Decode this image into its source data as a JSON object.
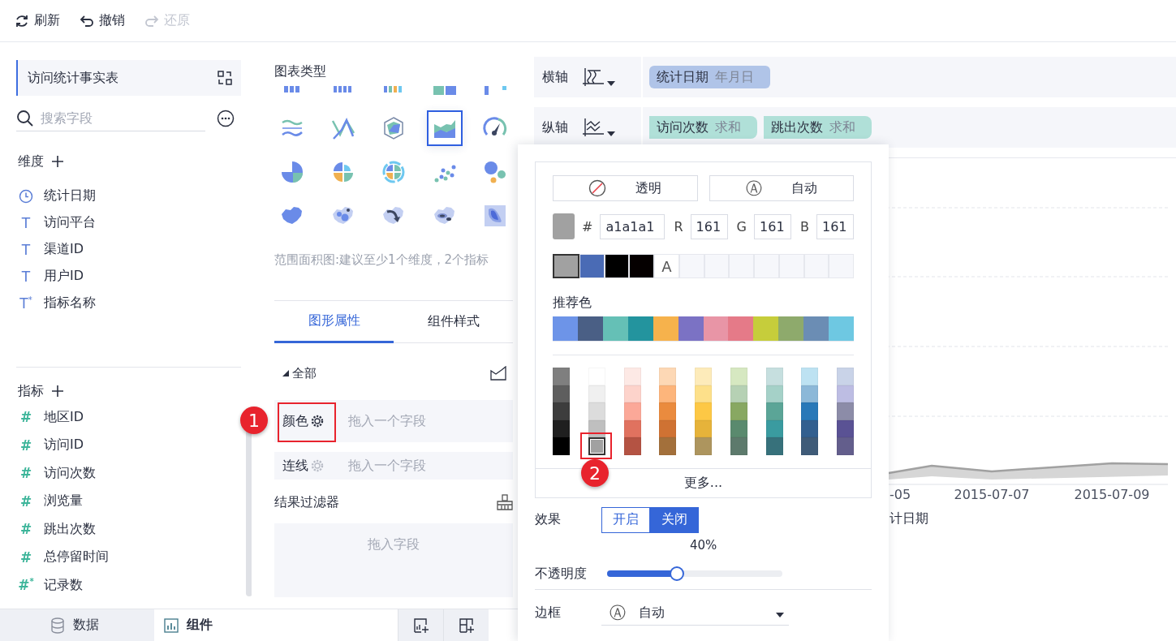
{
  "toolbar": [
    {
      "kind": "refresh",
      "label": "刷新",
      "disabled": false
    },
    {
      "kind": "undo",
      "label": "撤销",
      "disabled": false
    },
    {
      "kind": "redo",
      "label": "还原",
      "disabled": true
    }
  ],
  "data_panel": {
    "table": "访问统计事实表",
    "search": {
      "placeholder": "搜索字段"
    },
    "dimensions": {
      "title": "维度",
      "items": [
        {
          "kind": "date",
          "label": "统计日期"
        },
        {
          "kind": "dimension",
          "icon": "T",
          "label": "访问平台"
        },
        {
          "kind": "dimension",
          "icon": "T",
          "label": "渠道ID"
        },
        {
          "kind": "dimension",
          "icon": "T",
          "label": "用户ID"
        },
        {
          "kind": "dimension",
          "icon": "T$^{*}$",
          "label": "指标名称"
        }
      ]
    },
    "measures": {
      "title": "指标",
      "items": [
        {
          "kind": "measure",
          "icon": "#",
          "label": "地区ID"
        },
        {
          "kind": "measure",
          "icon": "#",
          "label": "访问ID"
        },
        {
          "kind": "measure",
          "icon": "#",
          "label": "访问次数"
        },
        {
          "kind": "measure",
          "icon": "#",
          "label": "浏览量"
        },
        {
          "kind": "measure",
          "icon": "#",
          "label": "跳出次数"
        },
        {
          "kind": "measure",
          "icon": "#",
          "label": "总停留时间"
        },
        {
          "kind": "measure",
          "icon": "#$^{*}$",
          "label": "记录数"
        }
      ]
    }
  },
  "bottom_tabs": [
    {
      "kind": "data",
      "label": "数据",
      "selected": false
    },
    {
      "kind": "component",
      "label": "组件",
      "selected": true
    }
  ],
  "chart_panel": {
    "title": "图表类型",
    "chart_types": [
      {
        "kind": "column",
        "selected": false
      },
      {
        "kind": "column-stack",
        "selected": false
      },
      {
        "kind": "column-multi",
        "selected": false
      },
      {
        "kind": "bar-range",
        "selected": false
      },
      {
        "kind": "column-partial",
        "selected": false
      },
      {
        "kind": "stream",
        "selected": false
      },
      {
        "kind": "line",
        "selected": false
      },
      {
        "kind": "radar",
        "selected": false
      },
      {
        "kind": "area",
        "selected": true
      },
      {
        "kind": "gauge",
        "selected": false
      },
      {
        "kind": "pie",
        "selected": false
      },
      {
        "kind": "rose",
        "selected": false
      },
      {
        "kind": "ring",
        "selected": false
      },
      {
        "kind": "scatter",
        "selected": false
      },
      {
        "kind": "bubble",
        "selected": false
      },
      {
        "kind": "map",
        "selected": false
      },
      {
        "kind": "map-point",
        "selected": false
      },
      {
        "kind": "map-flow",
        "selected": false
      },
      {
        "kind": "map-heat",
        "selected": false
      },
      {
        "kind": "map-region",
        "selected": false
      }
    ],
    "hint": "范围面积图:建议至少1个维度，2个指标",
    "tabs": [
      {
        "label": "图形属性",
        "selected": true
      },
      {
        "label": "组件样式",
        "selected": false
      }
    ],
    "group": {
      "label": "全部",
      "expanded": true
    },
    "properties": [
      {
        "label": "颜色",
        "placeholder": "拖入一个字段"
      },
      {
        "label": "连线",
        "placeholder": "拖入一个字段"
      }
    ],
    "filter": {
      "title": "结果过滤器",
      "placeholder": "拖入字段"
    }
  },
  "axes": [
    {
      "label": "横轴",
      "kind": "x",
      "fields": [
        {
          "name": "统计日期",
          "aggregation": "年月日"
        }
      ]
    },
    {
      "label": "纵轴",
      "kind": "y",
      "fields": [
        {
          "name": "访问次数",
          "aggregation": "求和"
        },
        {
          "name": "跳出次数",
          "aggregation": "求和"
        }
      ]
    }
  ],
  "chart": {
    "x_labels": [
      "-05",
      "2015-07-07",
      "2015-07-09"
    ],
    "axis_title": "计日期"
  },
  "color_popup": {
    "transparent": "透明",
    "auto_icon": "Ⓐ",
    "auto": "自动",
    "hash": "#",
    "hex": "a1a1a1",
    "channels": [
      {
        "label": "R",
        "value": "161"
      },
      {
        "label": "G",
        "value": "161"
      },
      {
        "label": "B",
        "value": "161"
      }
    ],
    "recent": [
      {
        "kind": "color",
        "color": "#a1a1a1",
        "selected": true
      },
      {
        "kind": "color",
        "color": "#4a6bb5",
        "selected": false
      },
      {
        "kind": "color",
        "color": "#000000",
        "selected": false
      },
      {
        "kind": "color",
        "color": "#050000",
        "selected": false
      },
      {
        "kind": "auto",
        "label": "A",
        "selected": false
      },
      {
        "kind": "empty",
        "selected": false
      },
      {
        "kind": "empty",
        "selected": false
      },
      {
        "kind": "empty",
        "selected": false
      },
      {
        "kind": "empty",
        "selected": false
      },
      {
        "kind": "empty",
        "selected": false
      },
      {
        "kind": "empty",
        "selected": false
      },
      {
        "kind": "empty",
        "selected": false
      }
    ],
    "recommended_title": "推荐色",
    "recommended": [
      {
        "color": "#6d94e8",
        "selected": false
      },
      {
        "color": "#4a5f85",
        "selected": false
      },
      {
        "color": "#65c0b6",
        "selected": false
      },
      {
        "color": "#23949e",
        "selected": false
      },
      {
        "color": "#f6b24c",
        "selected": false
      },
      {
        "color": "#7b72c4",
        "selected": false
      },
      {
        "color": "#e895a6",
        "selected": false
      },
      {
        "color": "#e57a88",
        "selected": false
      },
      {
        "color": "#c6cd3b",
        "selected": false
      },
      {
        "color": "#8eaa6c",
        "selected": false
      },
      {
        "color": "#6b8db4",
        "selected": false
      },
      {
        "color": "#6ec8e2",
        "selected": false
      }
    ],
    "shades": [
      {
        "cells": [
          {
            "color": "#7f7f7f",
            "selected": false
          },
          {
            "color": "#5e5e5e",
            "selected": false
          },
          {
            "color": "#3d3d3d",
            "selected": false
          },
          {
            "color": "#1f1f1f",
            "selected": false
          },
          {
            "color": "#000000",
            "selected": false
          }
        ]
      },
      {
        "cells": [
          {
            "color": "#ffffff",
            "selected": false
          },
          {
            "color": "#f0f0f0",
            "selected": false
          },
          {
            "color": "#dcdcdc",
            "selected": false
          },
          {
            "color": "#bfbfbf",
            "selected": false
          },
          {
            "color": "#a1a1a1",
            "selected": true
          }
        ]
      },
      {
        "cells": [
          {
            "color": "#fde9e5",
            "selected": false
          },
          {
            "color": "#fdd3cb",
            "selected": false
          },
          {
            "color": "#fba898",
            "selected": false
          },
          {
            "color": "#e0725f",
            "selected": false
          },
          {
            "color": "#b45343",
            "selected": false
          }
        ]
      },
      {
        "cells": [
          {
            "color": "#fdd8b5",
            "selected": false
          },
          {
            "color": "#fdb57b",
            "selected": false
          },
          {
            "color": "#ea8b3e",
            "selected": false
          },
          {
            "color": "#cf7233",
            "selected": false
          },
          {
            "color": "#a3703b",
            "selected": false
          }
        ]
      },
      {
        "cells": [
          {
            "color": "#fdebba",
            "selected": false
          },
          {
            "color": "#fde08a",
            "selected": false
          },
          {
            "color": "#fdc845",
            "selected": false
          },
          {
            "color": "#e6b33a",
            "selected": false
          },
          {
            "color": "#ad955e",
            "selected": false
          }
        ]
      },
      {
        "cells": [
          {
            "color": "#d6e8c1",
            "selected": false
          },
          {
            "color": "#b6d1b4",
            "selected": false
          },
          {
            "color": "#88a862",
            "selected": false
          },
          {
            "color": "#5a8a6e",
            "selected": false
          },
          {
            "color": "#5d7a6c",
            "selected": false
          }
        ]
      },
      {
        "cells": [
          {
            "color": "#c6dfdf",
            "selected": false
          },
          {
            "color": "#a5d1c8",
            "selected": false
          },
          {
            "color": "#5ba597",
            "selected": false
          },
          {
            "color": "#3a9ba0",
            "selected": false
          },
          {
            "color": "#37717b",
            "selected": false
          }
        ]
      },
      {
        "cells": [
          {
            "color": "#bde2f2",
            "selected": false
          },
          {
            "color": "#8cb8d8",
            "selected": false
          },
          {
            "color": "#2878b8",
            "selected": false
          },
          {
            "color": "#325f8f",
            "selected": false
          },
          {
            "color": "#3f5b78",
            "selected": false
          }
        ]
      },
      {
        "cells": [
          {
            "color": "#c9d3e8",
            "selected": false
          },
          {
            "color": "#bdbde3",
            "selected": false
          },
          {
            "color": "#8c8ca8",
            "selected": false
          },
          {
            "color": "#5a5294",
            "selected": false
          },
          {
            "color": "#635e8c",
            "selected": false
          }
        ]
      }
    ],
    "more": "更多...",
    "effect": {
      "label": "效果",
      "options": [
        {
          "label": "开启",
          "selected": false
        },
        {
          "label": "关闭",
          "selected": true
        }
      ]
    },
    "opacity": {
      "label": "不透明度",
      "reading": "40%",
      "level": 0.4
    },
    "border": {
      "label": "边框",
      "icon": "Ⓐ",
      "value": "自动"
    }
  },
  "annotations": [
    {
      "label": "1"
    },
    {
      "label": "2"
    }
  ]
}
